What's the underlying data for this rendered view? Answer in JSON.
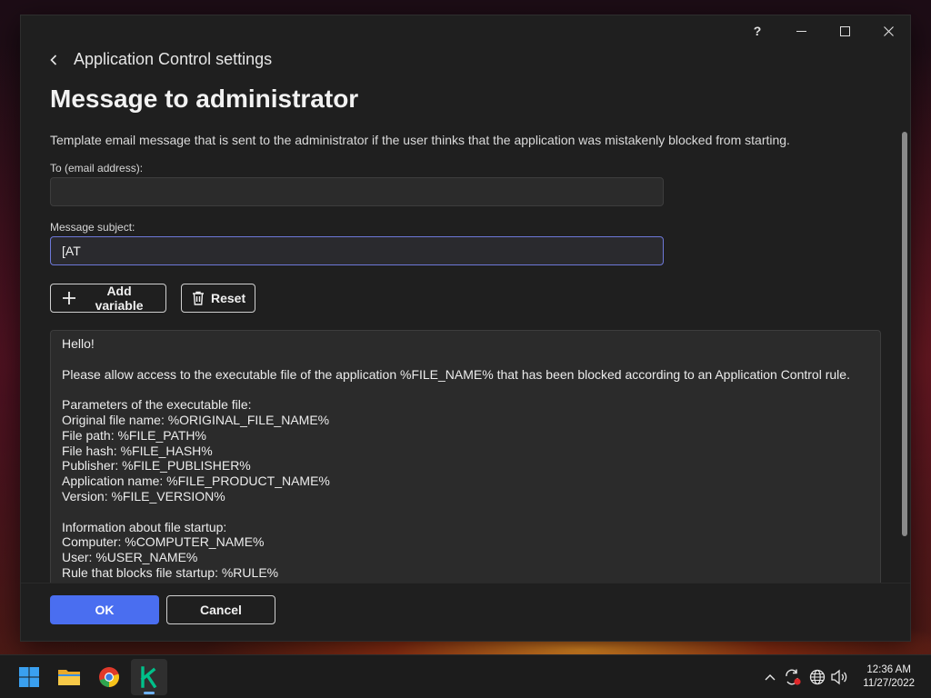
{
  "window": {
    "help_label": "?",
    "back_label": "Application Control settings",
    "title": "Message to administrator",
    "description": "Template email message that is sent to the administrator if the user thinks that the application was mistakenly blocked from starting."
  },
  "fields": {
    "to_label": "To (email address):",
    "to_value": "",
    "subject_label": "Message subject:",
    "subject_value": "[AT"
  },
  "buttons": {
    "add_variable": "Add variable",
    "reset": "Reset",
    "ok": "OK",
    "cancel": "Cancel"
  },
  "message_lines": [
    "Hello!",
    "",
    "Please allow access to the executable file of the application %FILE_NAME% that has been blocked according to an Application Control rule.",
    "",
    "Parameters of the executable file:",
    "Original file name: %ORIGINAL_FILE_NAME%",
    "File path: %FILE_PATH%",
    "File hash: %FILE_HASH%",
    "Publisher: %FILE_PUBLISHER%",
    "Application name: %FILE_PRODUCT_NAME%",
    "Version: %FILE_VERSION%",
    "",
    "Information about file startup:",
    "Computer: %COMPUTER_NAME%",
    "User: %USER_NAME%",
    "Rule that blocks file startup: %RULE%"
  ],
  "taskbar": {
    "apps": [
      "start-icon",
      "file-explorer-icon",
      "chrome-icon",
      "kaspersky-icon"
    ],
    "time": "12:36 AM",
    "date": "11/27/2022"
  },
  "colors": {
    "accent": "#4a6ef0",
    "focus_border": "#6d78d8",
    "window_bg": "#1f1f1f",
    "input_bg": "#2b2b2b",
    "kaspersky_green": "#00c08a"
  }
}
